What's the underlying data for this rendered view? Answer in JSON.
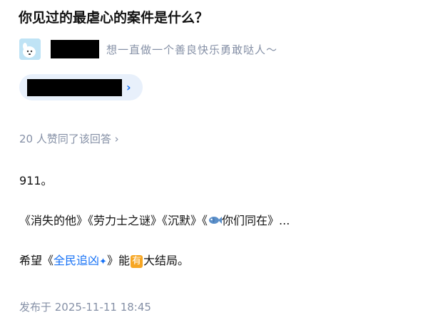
{
  "question": {
    "title": "你见过的最虐心的案件是什么？"
  },
  "author": {
    "bio": "想一直做一个善良快乐勇敢哒人～"
  },
  "pill": {
    "chevron": "›"
  },
  "likes": {
    "text": "20 人赞同了该回答 ›"
  },
  "answer": {
    "p1": "911。",
    "p2_before": "《消失的他》《劳力士之谜》《沉默》《",
    "p2_after": "你们同在》...",
    "p3_before": "希望《",
    "p3_link": "全民追凶",
    "p3_sparkle": "✦",
    "p3_mid": "》能",
    "p3_badge": "有",
    "p3_after": "大结局。"
  },
  "footer": {
    "published": "发布于 2025-11-11 18:45"
  },
  "colors": {
    "link": "#1772f6",
    "meta": "#8590a6",
    "pill_bg": "#e8f0fb",
    "badge": "#f6a623"
  },
  "icons": {
    "avatar": "cartoon-dog-avatar",
    "fish": "fish-emoji"
  }
}
